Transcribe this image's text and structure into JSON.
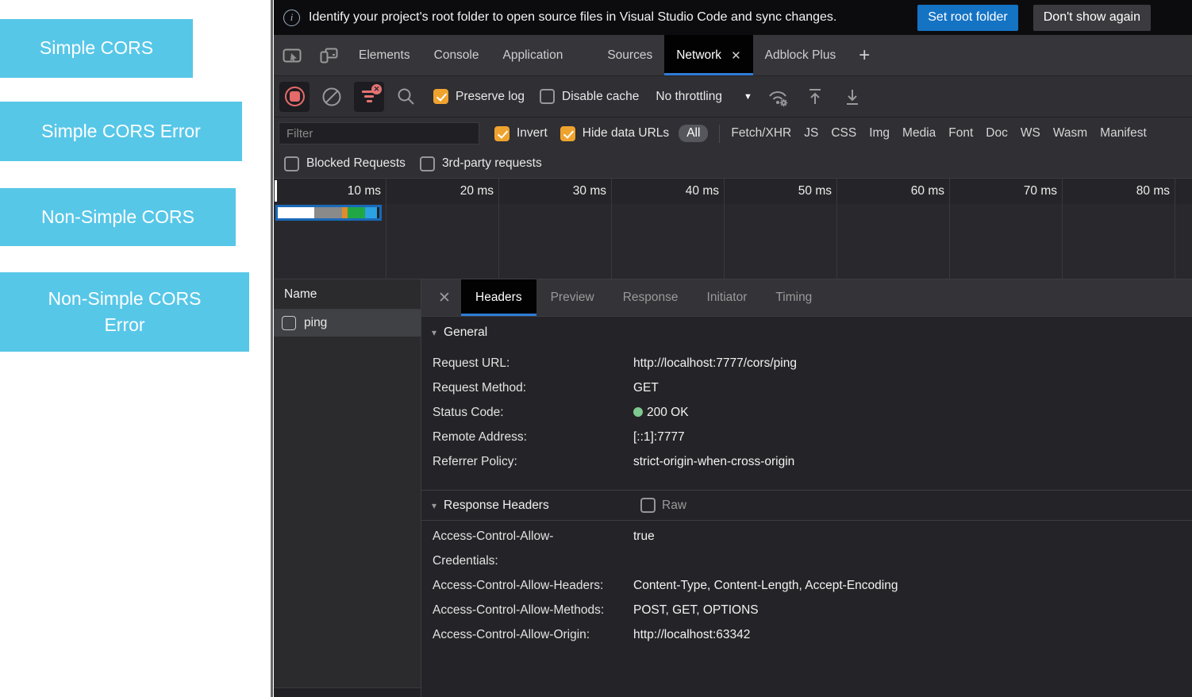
{
  "page": {
    "buttons": [
      {
        "label": "Simple CORS"
      },
      {
        "label": "Simple CORS Error"
      },
      {
        "label": "Non-Simple CORS"
      },
      {
        "label": "Non-Simple CORS Error"
      }
    ]
  },
  "devtools": {
    "infobar": {
      "icon": "i",
      "message": "Identify your project's root folder to open source files in Visual Studio Code and sync changes.",
      "primary_button": "Set root folder",
      "secondary_button": "Don't show again"
    },
    "tabs": {
      "items": [
        "Elements",
        "Console",
        "Application",
        "Sources",
        "Network",
        "Adblock Plus"
      ],
      "active": "Network",
      "close_glyph": "✕",
      "add_glyph": "+"
    },
    "toolbar": {
      "preserve_log": {
        "label": "Preserve log",
        "checked": true
      },
      "disable_cache": {
        "label": "Disable cache",
        "checked": false
      },
      "throttling": {
        "value": "No throttling",
        "arrow": "▼"
      }
    },
    "filter_bar": {
      "filter_placeholder": "Filter",
      "invert": {
        "label": "Invert",
        "checked": true
      },
      "hide_data_urls": {
        "label": "Hide data URLs",
        "checked": true
      },
      "types": [
        "All",
        "Fetch/XHR",
        "JS",
        "CSS",
        "Img",
        "Media",
        "Font",
        "Doc",
        "WS",
        "Wasm",
        "Manifest"
      ],
      "active_type": "All",
      "blocked_requests": {
        "label": "Blocked Requests",
        "checked": false
      },
      "third_party": {
        "label": "3rd-party requests",
        "checked": false
      }
    },
    "timeline": {
      "ticks": [
        "10 ms",
        "20 ms",
        "30 ms",
        "40 ms",
        "50 ms",
        "60 ms",
        "70 ms",
        "80 ms"
      ],
      "overview_segments": [
        {
          "color": "#ffffff",
          "width": "36%"
        },
        {
          "color": "#8a8a8a",
          "width": "27%"
        },
        {
          "color": "#df8c2c",
          "width": "6%"
        },
        {
          "color": "#21a845",
          "width": "17%"
        },
        {
          "color": "#2ba2e2",
          "width": "12%"
        }
      ]
    },
    "requests": {
      "name_header": "Name",
      "rows": [
        {
          "name": "ping",
          "selected": true
        }
      ]
    },
    "details": {
      "close_glyph": "✕",
      "tabs": [
        "Headers",
        "Preview",
        "Response",
        "Initiator",
        "Timing"
      ],
      "active_tab": "Headers",
      "triangle": "▾",
      "general": {
        "title": "General",
        "rows": [
          {
            "label": "Request URL:",
            "value": "http://localhost:7777/cors/ping"
          },
          {
            "label": "Request Method:",
            "value": "GET"
          },
          {
            "label": "Status Code:",
            "value": "200 OK"
          },
          {
            "label": "Remote Address:",
            "value": "[::1]:7777"
          },
          {
            "label": "Referrer Policy:",
            "value": "strict-origin-when-cross-origin"
          }
        ],
        "status_dot_color": "#7ec98f"
      },
      "response_headers": {
        "title": "Response Headers",
        "raw": {
          "label": "Raw",
          "checked": false
        },
        "rows": [
          {
            "label": "Access-Control-Allow-Credentials:",
            "value": "true"
          },
          {
            "label": "Access-Control-Allow-Headers:",
            "value": "Content-Type, Content-Length, Accept-Encoding"
          },
          {
            "label": "Access-Control-Allow-Methods:",
            "value": "POST, GET, OPTIONS"
          },
          {
            "label": "Access-Control-Allow-Origin:",
            "value": "http://localhost:63342"
          }
        ]
      }
    }
  },
  "colors": {
    "accent_blue": "#2e7cd6",
    "primary_button_blue": "#1573c4",
    "checkbox_checked_orange": "#efa32f",
    "record_red": "#e56a6a",
    "status_green": "#7ec98f",
    "page_button_blue": "#57c7e8"
  }
}
